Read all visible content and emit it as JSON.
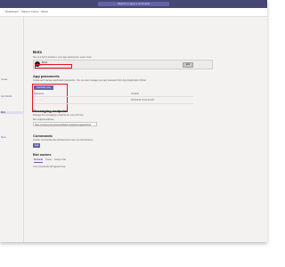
{
  "header": {
    "search_text": "Search or type a command"
  },
  "tabs": [
    "Dashboard",
    "Partner Center",
    "About"
  ],
  "sidebar": {
    "items": [
      "Create",
      "App Studio",
      "Bots",
      "Store"
    ]
  },
  "main": {
    "title": "Bots",
    "intro": "Set up a bot to include in your app deployment. Learn more",
    "bot": {
      "name": "Bot1",
      "id": "Bot ID: ··················",
      "button": "Edit"
    },
    "app_passwords": {
      "heading": "App passwords",
      "desc": "Create and manage application passwords. You can also manage your app password from App Registration Portal",
      "button": "Generate new password",
      "col_password": "Password",
      "col_created": "Created",
      "row_password": "···············",
      "row_created": "6/16/2019 10:01:20 AM"
    },
    "endpoint": {
      "heading": "Messaging endpoint",
      "desc": "Manage the messaging endpoints for your bot here",
      "label": "Bot endpoint address",
      "value": "https://contoso-bot.azurewebsites.net/api/messages/bot1"
    },
    "commands": {
      "heading": "Commands",
      "desc": "Include commands that will determine how your bot behaves.",
      "save": "Add"
    },
    "bot_names": {
      "heading": "Bot names",
      "tabs": [
        "Personal",
        "Teams",
        "Group Chat"
      ],
      "note": "Your commands will appear here."
    }
  },
  "colors": {
    "accent": "#6264a7",
    "titlebar": "#464775",
    "highlight": "#e81123"
  }
}
